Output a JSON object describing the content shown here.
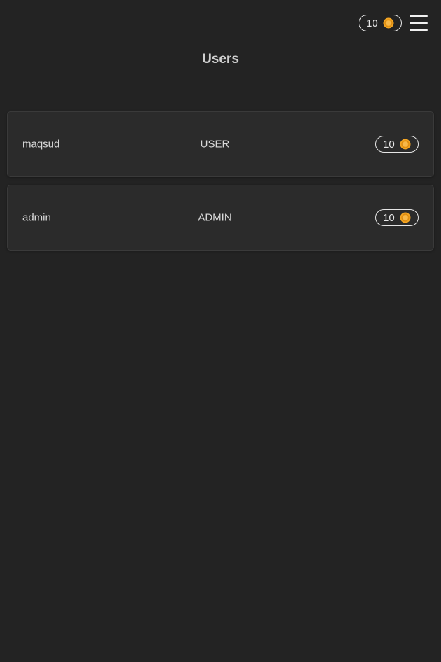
{
  "header": {
    "title": "Users",
    "coins": "10",
    "coin_icon": "coin-icon",
    "menu_icon": "hamburger-menu-icon"
  },
  "colors": {
    "background": "#232323",
    "card": "#2b2b2b",
    "coin": "#f5a623"
  },
  "users": [
    {
      "username": "maqsud",
      "role": "USER",
      "coins": "10"
    },
    {
      "username": "admin",
      "role": "ADMIN",
      "coins": "10"
    }
  ]
}
